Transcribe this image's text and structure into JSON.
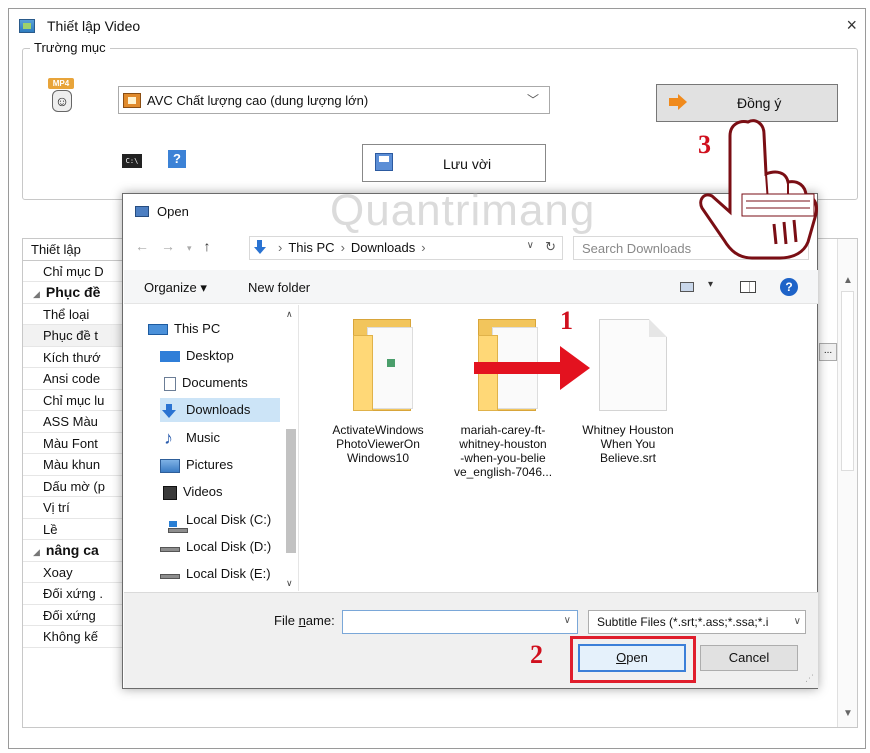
{
  "window": {
    "title": "Thiết lập Video",
    "close": "×",
    "group_label": "Trường mục",
    "mp4_badge": "MP4",
    "profile_value": "AVC Chất lượng cao (dung lượng lớn)",
    "agree_label": "Đồng ý",
    "saveas_label": "Lưu vời",
    "cmd_text": "C:\\",
    "help_text": "?"
  },
  "settings_grid": {
    "header": "Thiết lập",
    "rows": [
      {
        "label": "Chỉ mục D",
        "kind": "item"
      },
      {
        "label": "Phục đề",
        "kind": "cat"
      },
      {
        "label": "Thể loại",
        "kind": "item"
      },
      {
        "label": "Phục đề t",
        "kind": "item"
      },
      {
        "label": "Kích thướ",
        "kind": "item"
      },
      {
        "label": "Ansi code",
        "kind": "item"
      },
      {
        "label": "Chỉ mục lu",
        "kind": "item"
      },
      {
        "label": "ASS Màu",
        "kind": "item"
      },
      {
        "label": "Màu Font",
        "kind": "item"
      },
      {
        "label": "Màu khun",
        "kind": "item"
      },
      {
        "label": "Dấu mờ (p",
        "kind": "item"
      },
      {
        "label": "Vị trí",
        "kind": "item"
      },
      {
        "label": "Lề",
        "kind": "item"
      },
      {
        "label": "nâng ca",
        "kind": "cat"
      },
      {
        "label": "Xoay",
        "kind": "item"
      },
      {
        "label": "Đối xứng .",
        "kind": "item"
      },
      {
        "label": "Đối xứng",
        "kind": "item"
      },
      {
        "label": "Không kế",
        "kind": "item"
      }
    ],
    "ellipsis": "..."
  },
  "open_dialog": {
    "title": "Open",
    "address": {
      "crumb1": "This PC",
      "crumb2": "Downloads"
    },
    "search_placeholder": "Search Downloads",
    "toolbar": {
      "organize": "Organize ▾",
      "new_folder": "New folder",
      "help": "?"
    },
    "nav_items": [
      {
        "label": "This PC",
        "icon": "pc"
      },
      {
        "label": "Desktop",
        "icon": "desk"
      },
      {
        "label": "Documents",
        "icon": "doc"
      },
      {
        "label": "Downloads",
        "icon": "down"
      },
      {
        "label": "Music",
        "icon": "music"
      },
      {
        "label": "Pictures",
        "icon": "pics"
      },
      {
        "label": "Videos",
        "icon": "vids"
      },
      {
        "label": "Local Disk (C:)",
        "icon": "disk win"
      },
      {
        "label": "Local Disk (D:)",
        "icon": "disk"
      },
      {
        "label": "Local Disk (E:)",
        "icon": "disk"
      }
    ],
    "files": [
      {
        "lines": [
          "ActivateWindows",
          "PhotoViewerOn",
          "Windows10"
        ],
        "type": "folder"
      },
      {
        "lines": [
          "mariah-carey-ft-",
          "whitney-houston",
          "-when-you-belie",
          "ve_english-7046..."
        ],
        "type": "folder"
      },
      {
        "lines": [
          "Whitney Houston",
          "When You",
          "Believe.srt"
        ],
        "type": "file"
      }
    ],
    "file_name_label_pre": "File ",
    "file_name_label_u": "n",
    "file_name_label_post": "ame:",
    "file_name_value": "",
    "filter_value": "Subtitle Files (*.srt;*.ass;*.ssa;*.i",
    "open_u": "O",
    "open_rest": "pen",
    "cancel_label": "Cancel"
  },
  "annotations": {
    "step1": "1",
    "step2": "2",
    "step3": "3",
    "watermark": "Quantrimang"
  }
}
